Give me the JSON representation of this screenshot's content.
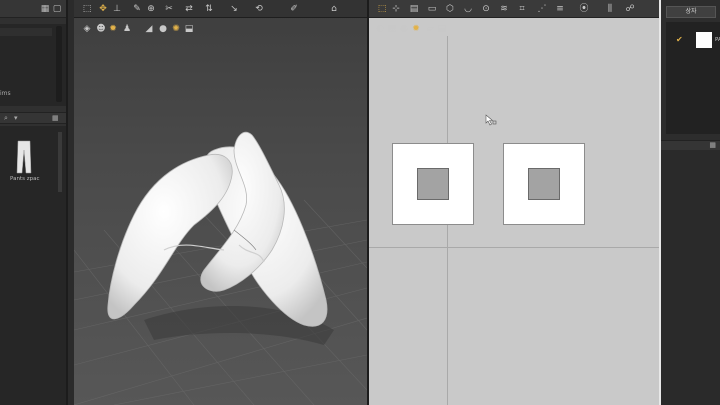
{
  "left_panel": {
    "list_label": "ims",
    "library_item": "Pants zpac"
  },
  "right_panel": {
    "button_label": "상자",
    "item_name": "PA"
  },
  "colors": {
    "accent": "#e2b24a",
    "pattern_fill": "#ffffff",
    "pattern_window_bg": "#c9c9c9"
  },
  "icons": {
    "left_toolbar": [
      "grid-icon",
      "square-icon"
    ],
    "vp3d_top": [
      "select-icon",
      "move-icon",
      "pin-icon",
      "brush-icon",
      "tack-icon",
      "scissors-icon",
      "tape-icon",
      "fold-icon",
      "arrow-icon",
      "transform-icon",
      "pen-icon",
      "fold-arrange-icon"
    ],
    "vp3d_sub": [
      "camera-icon",
      "avatar-icon",
      "sun-icon",
      "person-icon",
      "light-icon",
      "ghost-icon",
      "gold-sun-icon",
      "save-icon"
    ],
    "vp2d_top": [
      "select-pattern-icon",
      "edit-pattern-icon",
      "segment-icon",
      "rectangle-icon",
      "polygon-icon",
      "curve-icon",
      "point-icon",
      "seam-icon",
      "sew-icon",
      "free-sew-icon",
      "pleat-icon",
      "button-icon",
      "zipper-icon",
      "topstitch-icon"
    ],
    "vp2d_sub": [
      "view-icon",
      "texture-icon",
      "grain-icon",
      "gold-icon",
      "eraser-icon",
      "stack-icon"
    ]
  }
}
